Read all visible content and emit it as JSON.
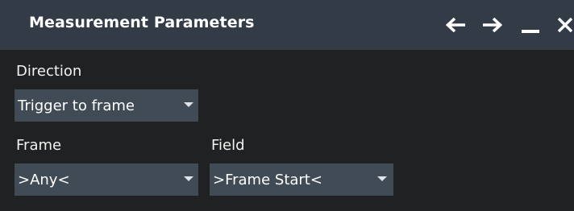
{
  "window": {
    "title": "Measurement Parameters",
    "controls": {
      "back_icon": "arrow-left-icon",
      "forward_icon": "arrow-right-icon",
      "minimize_icon": "minimize-icon",
      "close_icon": "close-icon"
    }
  },
  "form": {
    "direction": {
      "label": "Direction",
      "selected": "Trigger to frame"
    },
    "frame": {
      "label": "Frame",
      "selected": ">Any<"
    },
    "field": {
      "label": "Field",
      "selected": ">Frame Start<"
    }
  },
  "colors": {
    "titlebar": "#323b46",
    "background": "#1f2123",
    "dropdown": "#414b56",
    "text": "#ffffff"
  }
}
